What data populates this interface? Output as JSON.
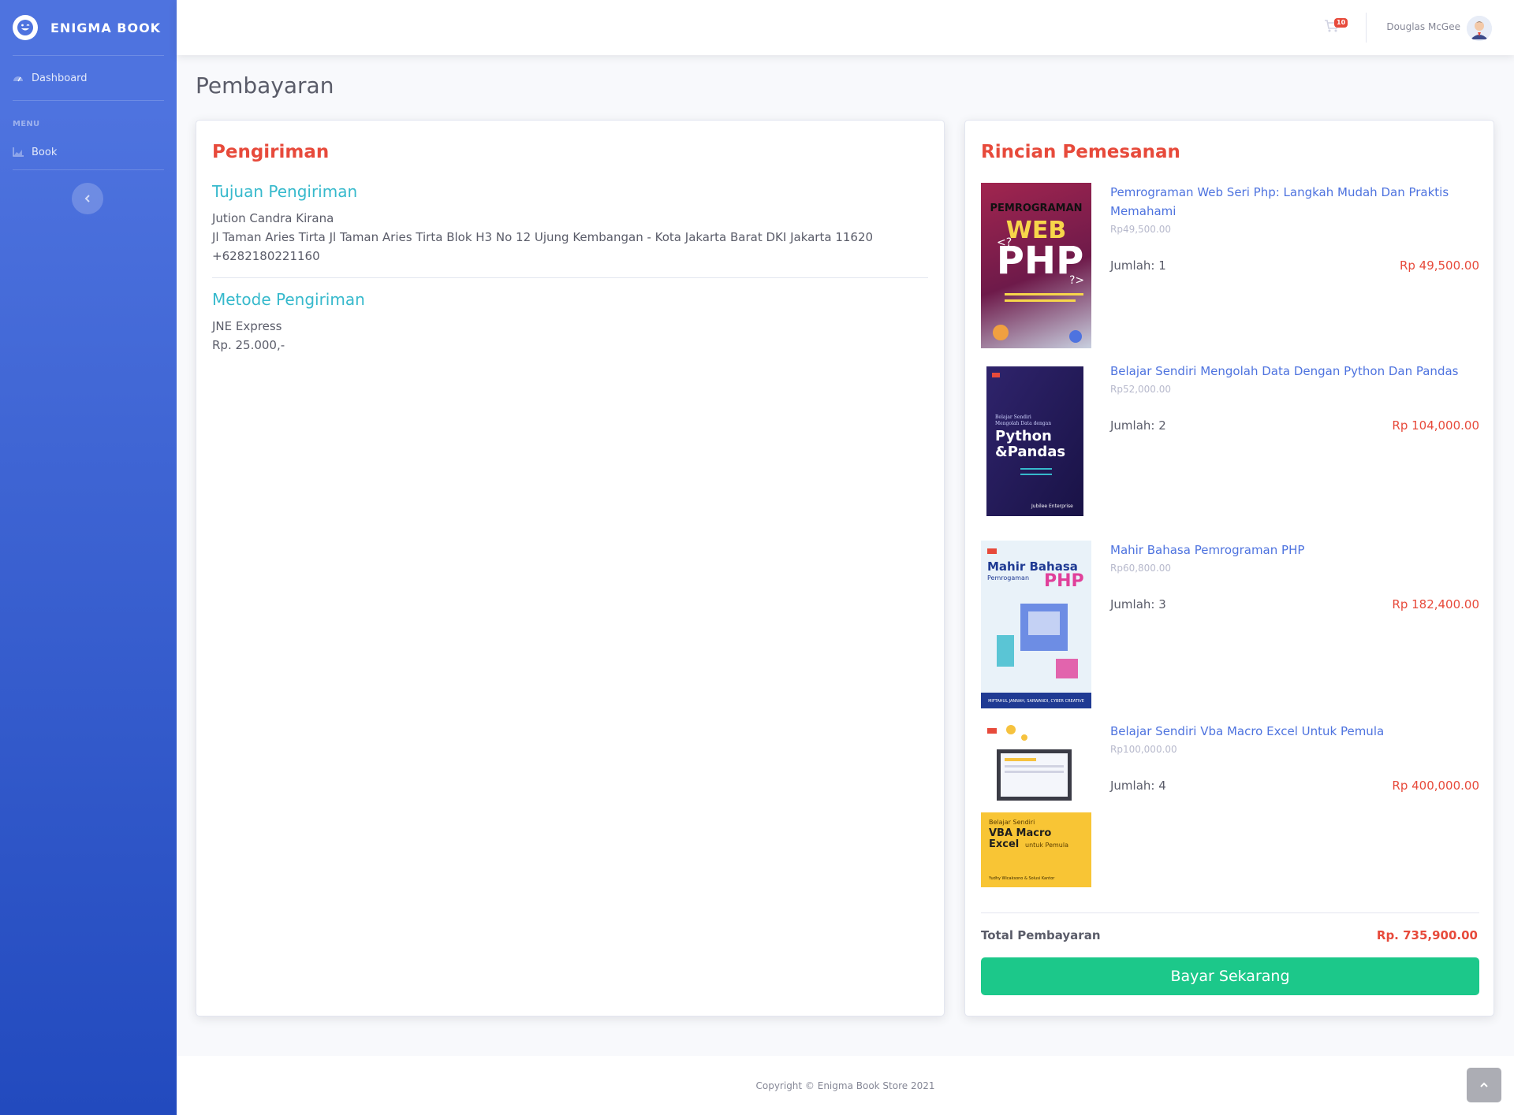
{
  "brand": {
    "name": "ENIGMA BOOK"
  },
  "sidebar": {
    "dashboard_label": "Dashboard",
    "menu_heading": "MENU",
    "book_label": "Book"
  },
  "topbar": {
    "cart_count": "10",
    "user_name": "Douglas McGee"
  },
  "page_title": "Pembayaran",
  "shipping": {
    "heading": "Pengiriman",
    "destination_heading": "Tujuan Pengiriman",
    "recipient": "Jution Candra Kirana",
    "address": "Jl Taman Aries Tirta Jl Taman Aries Tirta Blok H3 No 12 Ujung Kembangan - Kota Jakarta Barat DKI Jakarta 11620",
    "phone": "+6282180221160",
    "method_heading": "Metode Pengiriman",
    "courier": "JNE Express",
    "cost": "Rp. 25.000,-"
  },
  "order": {
    "heading": "Rincian Pemesanan",
    "items": [
      {
        "title": "Pemrograman Web Seri Php: Langkah Mudah Dan Praktis Memahami",
        "price": "Rp49,500.00",
        "qty": "Jumlah: 1",
        "subtotal": "Rp 49,500.00",
        "cover_text": "PEMROGRAMAN WEB PHP"
      },
      {
        "title": "Belajar Sendiri Mengolah Data Dengan Python Dan Pandas",
        "price": "Rp52,000.00",
        "qty": "Jumlah: 2",
        "subtotal": "Rp 104,000.00",
        "cover_text": "Python & Pandas"
      },
      {
        "title": "Mahir Bahasa Pemrograman PHP",
        "price": "Rp60,800.00",
        "qty": "Jumlah: 3",
        "subtotal": "Rp 182,400.00",
        "cover_text": "Mahir Bahasa PHP"
      },
      {
        "title": "Belajar Sendiri Vba Macro Excel Untuk Pemula",
        "price": "Rp100,000.00",
        "qty": "Jumlah: 4",
        "subtotal": "Rp 400,000.00",
        "cover_text": "VBA Macro Excel"
      }
    ],
    "total_label": "Total Pembayaran",
    "total_value": "Rp. 735,900.00",
    "pay_button": "Bayar Sekarang"
  },
  "footer": {
    "copyright": "Copyright © Enigma Book Store 2021"
  },
  "colors": {
    "primary": "#4e73df",
    "danger": "#e74a3b",
    "info": "#36b9cc",
    "success": "#1cc88a"
  }
}
